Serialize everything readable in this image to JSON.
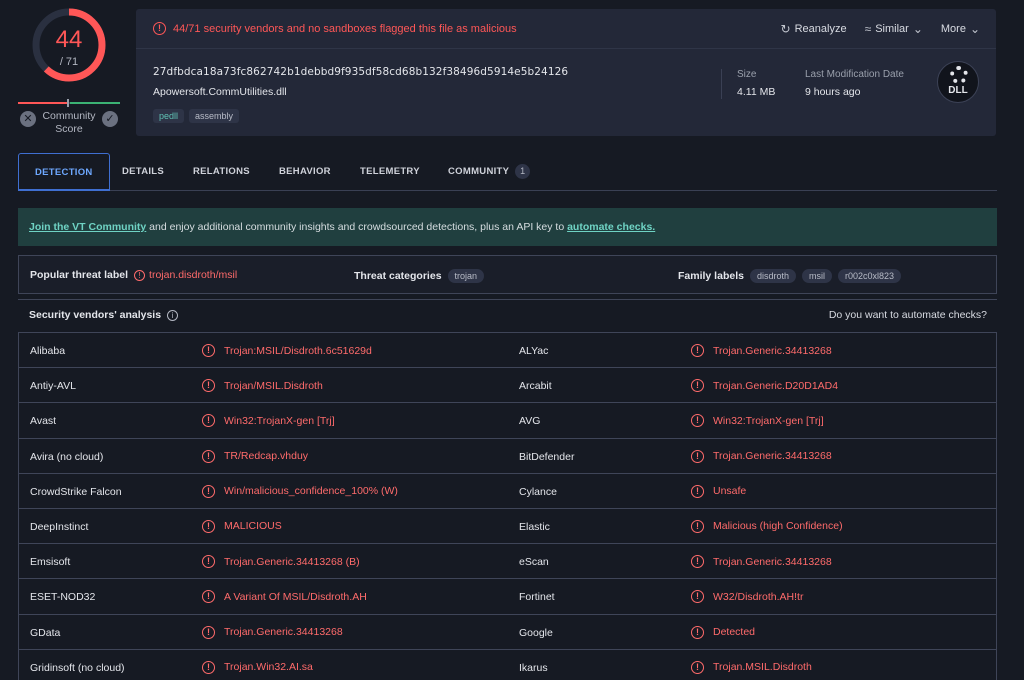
{
  "score": {
    "detected": "44",
    "total": "/ 71",
    "community_label": "Community Score"
  },
  "header": {
    "alert": "44/71 security vendors and no sandboxes flagged this file as malicious",
    "actions": {
      "reanalyze": "Reanalyze",
      "similar": "Similar",
      "more": "More"
    },
    "hash": "27dfbdca18a73fc862742b1debbd9f935df58cd68b132f38496d5914e5b24126",
    "file_name": "Apowersoft.CommUtilities.dll",
    "tags": [
      "pedll",
      "assembly"
    ],
    "size_label": "Size",
    "size_value": "4.11 MB",
    "mod_label": "Last Modification Date",
    "mod_value": "9 hours ago",
    "file_type": "DLL"
  },
  "tabs": {
    "detection": "DETECTION",
    "details": "DETAILS",
    "relations": "RELATIONS",
    "behavior": "BEHAVIOR",
    "telemetry": "TELEMETRY",
    "community": "COMMUNITY",
    "community_count": "1"
  },
  "banner": {
    "link1": "Join the VT Community",
    "text": " and enjoy additional community insights and crowdsourced detections, plus an API key to ",
    "link2": "automate checks."
  },
  "threat": {
    "popular_label": "Popular threat label",
    "popular_value": "trojan.disdroth/msil",
    "categories_label": "Threat categories",
    "categories": [
      "trojan"
    ],
    "family_label": "Family labels",
    "families": [
      "disdroth",
      "msil",
      "r002c0xl823"
    ]
  },
  "analysis": {
    "title": "Security vendors' analysis",
    "automate": "Do you want to automate checks?",
    "rows": [
      [
        "Alibaba",
        "Trojan:MSIL/Disdroth.6c51629d",
        "ALYac",
        "Trojan.Generic.34413268"
      ],
      [
        "Antiy-AVL",
        "Trojan/MSIL.Disdroth",
        "Arcabit",
        "Trojan.Generic.D20D1AD4"
      ],
      [
        "Avast",
        "Win32:TrojanX-gen [Trj]",
        "AVG",
        "Win32:TrojanX-gen [Trj]"
      ],
      [
        "Avira (no cloud)",
        "TR/Redcap.vhduy",
        "BitDefender",
        "Trojan.Generic.34413268"
      ],
      [
        "CrowdStrike Falcon",
        "Win/malicious_confidence_100% (W)",
        "Cylance",
        "Unsafe"
      ],
      [
        "DeepInstinct",
        "MALICIOUS",
        "Elastic",
        "Malicious (high Confidence)"
      ],
      [
        "Emsisoft",
        "Trojan.Generic.34413268 (B)",
        "eScan",
        "Trojan.Generic.34413268"
      ],
      [
        "ESET-NOD32",
        "A Variant Of MSIL/Disdroth.AH",
        "Fortinet",
        "W32/Disdroth.AH!tr"
      ],
      [
        "GData",
        "Trojan.Generic.34413268",
        "Google",
        "Detected"
      ],
      [
        "Gridinsoft (no cloud)",
        "Trojan.Win32.AI.sa",
        "Ikarus",
        "Trojan.MSIL.Disdroth"
      ]
    ]
  },
  "colors": {
    "malicious": "#ff5757",
    "accent": "#3f6fd1",
    "banner_link": "#6fd3c4"
  }
}
